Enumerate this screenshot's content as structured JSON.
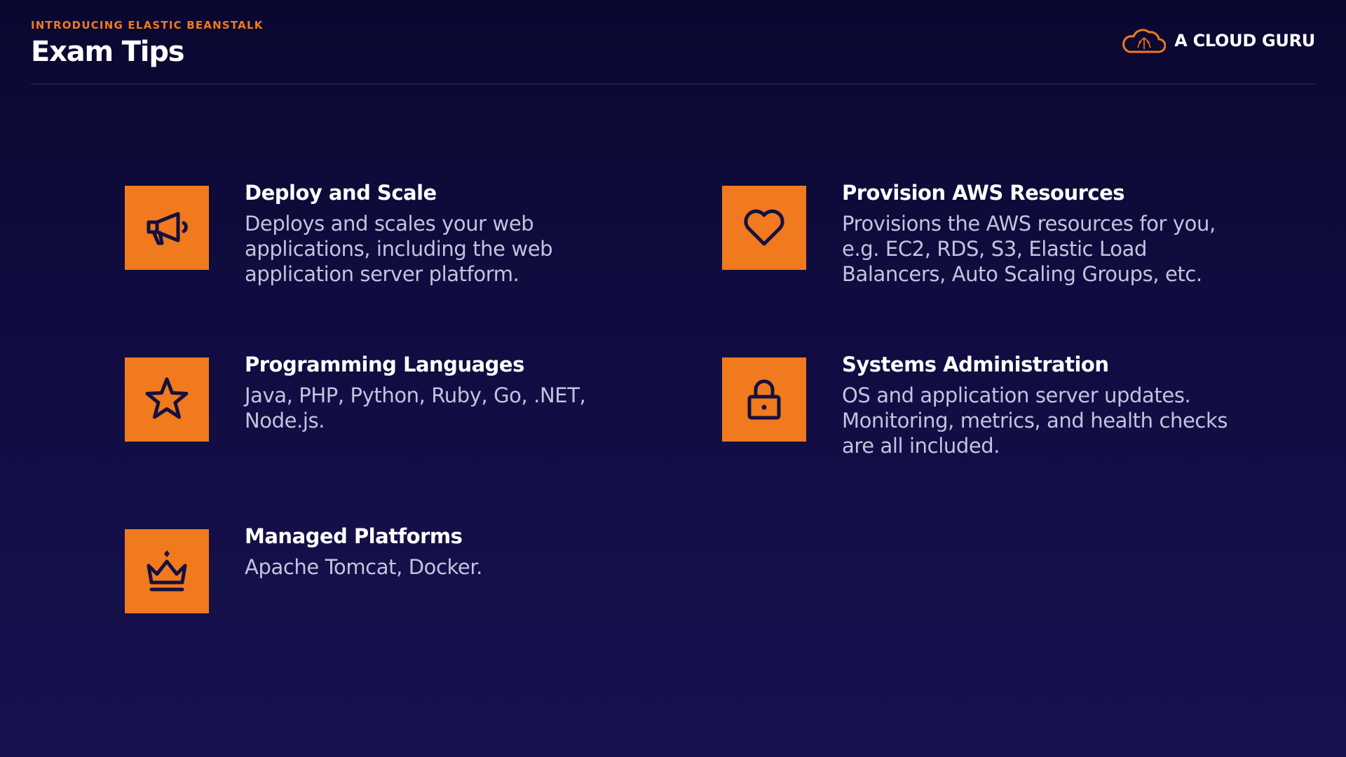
{
  "header": {
    "eyebrow": "INTRODUCING ELASTIC BEANSTALK",
    "title": "Exam Tips"
  },
  "brand": {
    "name": "A CLOUD GURU",
    "logo_icon": "cloud-icon"
  },
  "colors": {
    "accent": "#f07a1d",
    "background": "#100c40",
    "icon_stroke": "#151040",
    "description_text": "#c6c2de"
  },
  "tips": [
    {
      "icon": "megaphone-icon",
      "title": "Deploy and Scale",
      "lines": [
        "Deploys and scales your web",
        "applications, including the web",
        "application server platform."
      ]
    },
    {
      "icon": "heart-icon",
      "title": "Provision AWS Resources",
      "lines": [
        "Provisions the AWS resources for you,",
        "e.g. EC2, RDS, S3, Elastic Load",
        "Balancers, Auto Scaling Groups, etc."
      ]
    },
    {
      "icon": "star-icon",
      "title": "Programming Languages",
      "lines": [
        "Java, PHP, Python, Ruby, Go, .NET,",
        "Node.js."
      ]
    },
    {
      "icon": "lock-icon",
      "title": "Systems Administration",
      "lines": [
        "OS and application server updates.",
        "Monitoring, metrics, and health checks",
        "are all included."
      ]
    },
    {
      "icon": "crown-icon",
      "title": "Managed Platforms",
      "lines": [
        "Apache Tomcat, Docker."
      ]
    }
  ]
}
